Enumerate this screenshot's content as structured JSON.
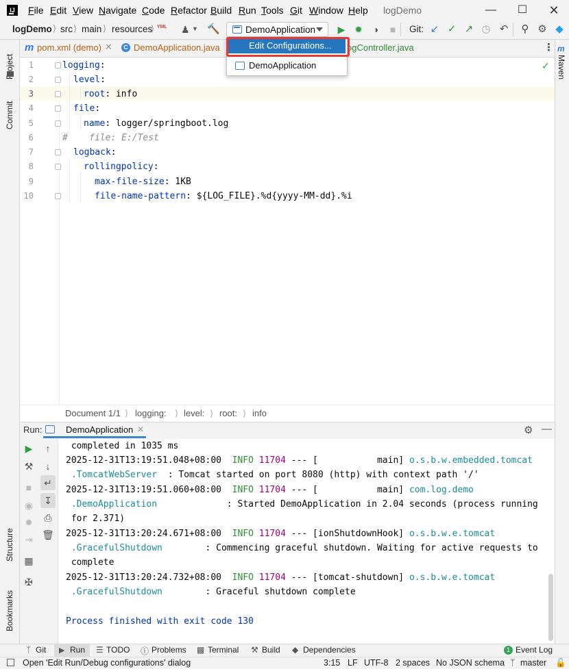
{
  "menubar": {
    "items": [
      "File",
      "Edit",
      "View",
      "Navigate",
      "Code",
      "Refactor",
      "Build",
      "Run",
      "Tools",
      "Git",
      "Window",
      "Help"
    ],
    "mnemonics": [
      "F",
      "E",
      "V",
      "N",
      "C",
      "R",
      "B",
      "R",
      "T",
      "G",
      "W",
      "H"
    ],
    "window_title": "logDemo",
    "window_buttons": [
      "minimize",
      "maximize",
      "close"
    ]
  },
  "navbar": {
    "breadcrumbs": [
      "logDemo",
      "src",
      "main",
      "resources"
    ],
    "yaml_badge": "YML",
    "run_configuration": "DemoApplication",
    "git_label": "Git:"
  },
  "tabs": {
    "items": [
      "pom.xml (demo)",
      "DemoApplication.java",
      "ogController.java"
    ],
    "pom_icon": "m"
  },
  "sidebar_left": {
    "items": [
      "Project",
      "Commit",
      "Structure",
      "Bookmarks"
    ]
  },
  "sidebar_right": {
    "items": [
      "Maven"
    ]
  },
  "popup": {
    "items": [
      "Edit Configurations...",
      "DemoApplication"
    ],
    "selected": "Edit Configurations..."
  },
  "editor": {
    "line_numbers": [
      "1",
      "2",
      "3",
      "4",
      "5",
      "6",
      "7",
      "8",
      "9",
      "10"
    ],
    "lines": [
      {
        "key": "logging",
        "sep": ":",
        "value": ""
      },
      {
        "key": "level",
        "sep": ":",
        "value": ""
      },
      {
        "key": "root",
        "sep": ":",
        "value": " info"
      },
      {
        "key": "file",
        "sep": ":",
        "value": ""
      },
      {
        "key": "name",
        "sep": ":",
        "value": " logger/springboot.log"
      },
      {
        "comment": "#    file: E:/Test"
      },
      {
        "key": "logback",
        "sep": ":",
        "value": ""
      },
      {
        "key": "rollingpolicy",
        "sep": ":",
        "value": ""
      },
      {
        "key": "max-file-size",
        "sep": ":",
        "value": " 1KB"
      },
      {
        "key": "file-name-pattern",
        "sep": ":",
        "value": " ${LOG_FILE}.%d{yyyy-MM-dd}.%i"
      }
    ],
    "breadcrumbs": [
      "Document 1/1",
      "logging:",
      "level:",
      "root:",
      "info"
    ]
  },
  "run": {
    "label": "Run:",
    "tab": "DemoApplication",
    "console": {
      "line0": " completed in 1035 ms",
      "entries": [
        {
          "ts": "2025-12-31T13:19:51.048+08:00",
          "level": "INFO",
          "pid": "11704",
          "sep": "--- [",
          "thread": "           main]",
          "logger1": "o.s.b.w.embedded.tomcat",
          "logger2": ".TomcatWebServer",
          "msg": "  : Tomcat started on port 8080 (http) with context path '/'",
          "msg2": ""
        },
        {
          "ts": "2025-12-31T13:19:51.060+08:00",
          "level": "INFO",
          "pid": "11704",
          "sep": "--- [",
          "thread": "           main]",
          "logger1": "com.log.demo",
          "logger2": ".DemoApplication",
          "msg": "             : Started DemoApplication in 2.04 seconds (process running",
          "msg2": " for 2.371)"
        },
        {
          "ts": "2025-12-31T13:20:24.671+08:00",
          "level": "INFO",
          "pid": "11704",
          "sep": "--- [",
          "thread": "ionShutdownHook]",
          "logger1": "o.s.b.w.e.tomcat",
          "logger2": ".GracefulShutdown",
          "msg": "        : Commencing graceful shutdown. Waiting for active requests to",
          "msg2": " complete"
        },
        {
          "ts": "2025-12-31T13:20:24.732+08:00",
          "level": "INFO",
          "pid": "11704",
          "sep": "--- [",
          "thread": "tomcat-shutdown]",
          "logger1": "o.s.b.w.e.tomcat",
          "logger2": ".GracefulShutdown",
          "msg": "        : Graceful shutdown complete",
          "msg2": ""
        }
      ],
      "exit_line": "Process finished with exit code 130"
    }
  },
  "bottom_toolbar": {
    "items": [
      "Git",
      "Run",
      "TODO",
      "Problems",
      "Terminal",
      "Build",
      "Dependencies"
    ],
    "event_log": "Event Log",
    "event_log_badge": "1"
  },
  "status_bar": {
    "message": "Open 'Edit Run/Debug configurations' dialog",
    "position": "3:15",
    "line_separator": "LF",
    "encoding": "UTF-8",
    "indent": "2 spaces",
    "schema": "No JSON schema",
    "branch": "master"
  },
  "colors": {
    "accent": "#2675bf",
    "highlight_border": "#e53935",
    "run_green": "#2f9e44",
    "yaml_key": "#0033b3"
  }
}
